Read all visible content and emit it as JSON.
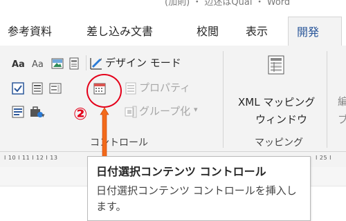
{
  "window": {
    "title_fragment": "(加則) ・ 辺述はQuai ・ Word"
  },
  "tabs": [
    {
      "label": "参考資料"
    },
    {
      "label": "差し込み文書"
    },
    {
      "label": "校閲"
    },
    {
      "label": "表示"
    },
    {
      "label": "開発",
      "active": true
    }
  ],
  "controls_group": {
    "design_mode_label": "デザイン モード",
    "properties_label": "プロパティ",
    "group_label": "グループ化",
    "group_label_caret": "▾",
    "section_label": "コントロール"
  },
  "mapping_group": {
    "xml_mapping_line1": "XML マッピング",
    "xml_mapping_line2": "ウィンドウ",
    "section_label": "マッピング",
    "clipped_right_top": "編",
    "clipped_right_bottom": "ブ"
  },
  "ruler": {
    "left_ticks": "I 10 I 11 I 12 I 13",
    "right_ticks": "I 25 I"
  },
  "annotation": {
    "step_label": "②",
    "accent_color": "#e4001a"
  },
  "tooltip": {
    "title": "日付選択コンテンツ コントロール",
    "description": "日付選択コンテンツ コントロールを挿入します。"
  },
  "colors": {
    "ribbon_bg": "#f3f3f3",
    "active_tab_text": "#2b579a"
  }
}
